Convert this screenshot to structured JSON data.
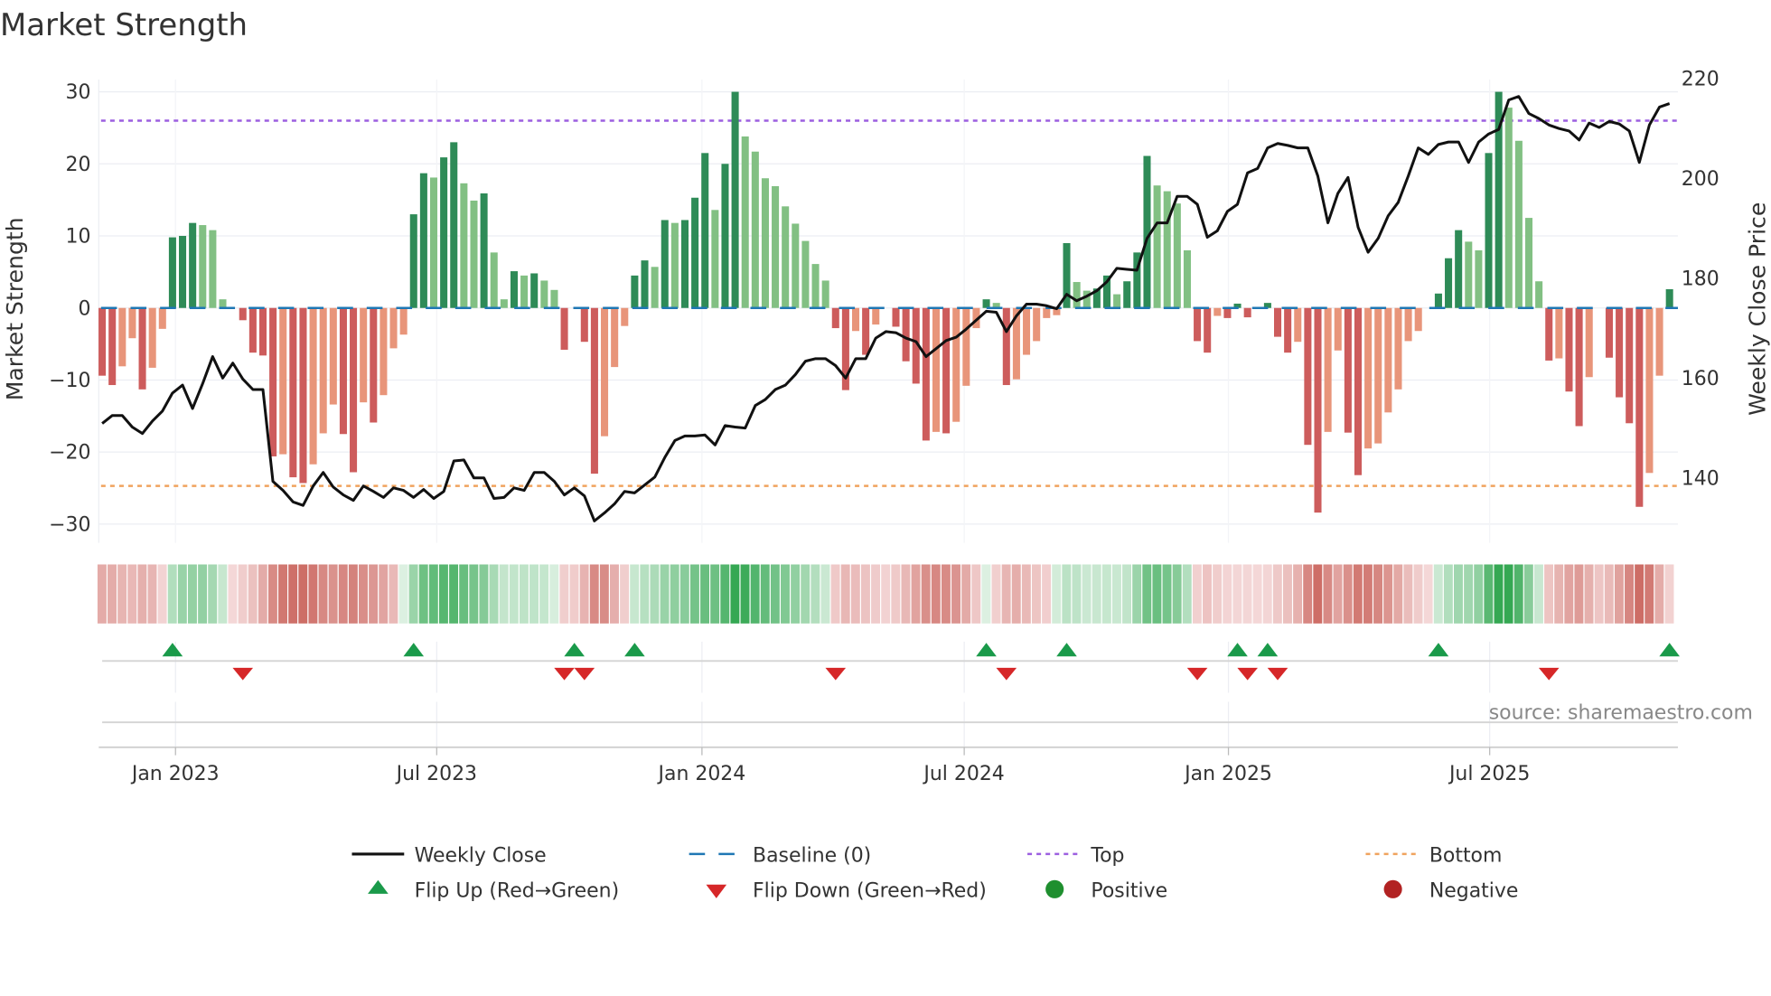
{
  "chart_data": {
    "type": "bar",
    "title": "Market Strength",
    "ylabel": "Market Strength",
    "y2label": "Weekly Close Price",
    "ylim": [
      -32.6,
      31.7
    ],
    "y2lim": [
      127,
      219.8
    ],
    "yticks": [
      30,
      20,
      10,
      0,
      -10,
      -20,
      -30
    ],
    "yticklabels": [
      "30",
      "20",
      "10",
      "0",
      "−10",
      "−20",
      "−30"
    ],
    "y2ticks": [
      220,
      200,
      180,
      160,
      140
    ],
    "y2ticklabels": [
      "220",
      "200",
      "180",
      "160",
      "140"
    ],
    "xticks": [
      7.3,
      33.3,
      59.7,
      85.8,
      112.1,
      138.1
    ],
    "xticklabels": [
      "Jan 2023",
      "Jul 2023",
      "Jan 2024",
      "Jul 2024",
      "Jan 2025",
      "Jul 2025"
    ],
    "top_level": 26,
    "bottom_level": -24.7,
    "baseline": 0,
    "strength": [
      -9.4,
      -10.7,
      -8.1,
      -4.2,
      -11.3,
      -8.3,
      -2.9,
      9.8,
      10,
      11.8,
      11.5,
      10.8,
      1.2,
      0,
      -1.7,
      -6.2,
      -6.6,
      -20.6,
      -20.3,
      -23.5,
      -24.3,
      -21.7,
      -17.4,
      -13.4,
      -17.5,
      -22.8,
      -13.1,
      -15.9,
      -12.1,
      -5.6,
      -3.7,
      13,
      18.7,
      18.1,
      20.9,
      23,
      17.3,
      14.9,
      15.9,
      7.7,
      1.2,
      5.1,
      4.5,
      4.8,
      3.8,
      2.5,
      -5.8,
      0,
      -4.7,
      -23,
      -17.8,
      -8.2,
      -2.5,
      4.5,
      6.6,
      5.7,
      12.2,
      11.8,
      12.2,
      15.3,
      21.5,
      13.6,
      20,
      30,
      23.8,
      21.7,
      18,
      16.9,
      14.1,
      11.7,
      9.3,
      6.1,
      3.8,
      -2.8,
      -11.4,
      -3.2,
      -6.5,
      -2.3,
      0,
      -2.6,
      -7.4,
      -10.5,
      -18.4,
      -17.2,
      -17.4,
      -15.8,
      -10.8,
      -2.8,
      1.2,
      0.7,
      -10.7,
      -9.9,
      -6.5,
      -4.6,
      -1.4,
      -1,
      9,
      3.6,
      2.4,
      2.7,
      4.5,
      1.9,
      3.7,
      7.7,
      21.1,
      17,
      16.2,
      14.5,
      8,
      -4.6,
      -6.2,
      -1.1,
      -1.4,
      0.6,
      -1.3,
      0,
      0.7,
      -4,
      -6.2,
      -4.7,
      -19,
      -28.4,
      -17.2,
      -5.9,
      -17.3,
      -23.2,
      -19.5,
      -18.8,
      -14.5,
      -11.3,
      -4.6,
      -3.2,
      0,
      2,
      6.9,
      10.8,
      9.2,
      8,
      21.5,
      30,
      27.8,
      23.2,
      12.5,
      3.7,
      -7.3,
      -7,
      -11.6,
      -16.4,
      -9.6,
      0,
      -6.9,
      -12.4,
      -16,
      -27.6,
      -22.9,
      -9.4,
      2.6
    ],
    "weekly_close": [
      150.9,
      152.5,
      152.5,
      150.2,
      148.9,
      151.4,
      153.4,
      157.0,
      158.6,
      153.9,
      158.9,
      164.3,
      160.0,
      163.0,
      159.8,
      157.7,
      157.7,
      139.3,
      137.5,
      135.2,
      134.5,
      138.4,
      141.1,
      138.2,
      136.6,
      135.5,
      138.4,
      137.3,
      136.1,
      138.0,
      137.5,
      136.1,
      137.7,
      135.9,
      137.3,
      143.4,
      143.6,
      140.0,
      140.0,
      135.9,
      136.1,
      138.0,
      137.5,
      141.1,
      141.1,
      139.3,
      136.6,
      138.0,
      136.4,
      131.4,
      133.0,
      134.8,
      137.3,
      137.0,
      138.6,
      140.2,
      144.1,
      147.5,
      148.4,
      148.4,
      148.6,
      146.6,
      150.5,
      150.2,
      150.0,
      154.5,
      155.7,
      157.7,
      158.6,
      160.7,
      163.4,
      163.9,
      163.9,
      162.5,
      160.0,
      163.9,
      163.9,
      168.0,
      169.3,
      169.1,
      168.0,
      167.3,
      164.3,
      165.9,
      167.5,
      168.2,
      169.8,
      171.6,
      173.4,
      173.2,
      169.3,
      172.5,
      174.8,
      174.8,
      174.5,
      173.9,
      176.8,
      175.5,
      176.4,
      177.5,
      179.3,
      182.0,
      181.8,
      181.6,
      188.0,
      191.1,
      191.1,
      196.4,
      196.4,
      194.8,
      188.2,
      189.5,
      193.4,
      194.8,
      201.1,
      202.0,
      206.1,
      207.0,
      206.6,
      206.1,
      206.1,
      200.5,
      191.1,
      197.0,
      200.2,
      190.2,
      185.2,
      188.0,
      192.5,
      195.2,
      200.5,
      206.1,
      204.8,
      206.8,
      207.3,
      207.3,
      203.2,
      207.3,
      208.9,
      209.8,
      215.7,
      216.4,
      213.0,
      212.0,
      210.7,
      210.0,
      209.5,
      207.7,
      211.1,
      210.2,
      211.4,
      210.9,
      209.5,
      203.2,
      210.7,
      214.3,
      215.0
    ],
    "flip_up_weeks": [
      7,
      31,
      47,
      53,
      88,
      96,
      113,
      116,
      133,
      156
    ],
    "flip_down_weeks": [
      14,
      46,
      48,
      73,
      90,
      109,
      114,
      117,
      144
    ],
    "legend": {
      "weekly_close": "Weekly Close",
      "baseline": "Baseline (0)",
      "top": "Top",
      "bottom": "Bottom",
      "flip_up": "Flip Up (Red→Green)",
      "flip_down": "Flip Down (Green→Red)",
      "positive": "Positive",
      "negative": "Negative"
    },
    "legend_placement": "bottom",
    "source": "source: sharemaestro.com",
    "colors": {
      "pos_rising": "#2e8b57",
      "pos_falling": "#82c083",
      "neg_falling": "#cd5c5c",
      "neg_rising": "#e8957a",
      "line": "#111111",
      "baseline": "#1f77b4",
      "top": "#9c5fe0",
      "bottom": "#f0a35e",
      "flip_up": "#1a9a4a",
      "flip_down": "#d62728",
      "positive": "#1f8f2f",
      "negative": "#b22222"
    }
  }
}
